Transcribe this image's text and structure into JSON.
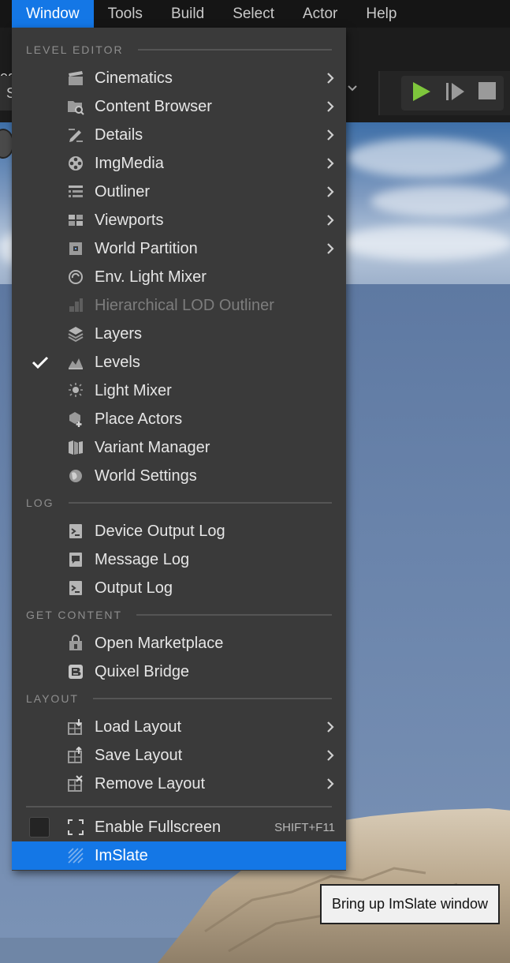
{
  "menubar": {
    "items": [
      {
        "label": "Window",
        "active": true
      },
      {
        "label": "Tools"
      },
      {
        "label": "Build"
      },
      {
        "label": "Select"
      },
      {
        "label": "Actor"
      },
      {
        "label": "Help"
      }
    ]
  },
  "toolbar": {
    "left_text": "ed",
    "combo_text": "S"
  },
  "menu": {
    "sections": [
      {
        "label": "LEVEL EDITOR",
        "items": [
          {
            "label": "Cinematics",
            "icon": "clapperboard-icon",
            "submenu": true
          },
          {
            "label": "Content Browser",
            "icon": "folder-search-icon",
            "submenu": true
          },
          {
            "label": "Details",
            "icon": "pencil-details-icon",
            "submenu": true
          },
          {
            "label": "ImgMedia",
            "icon": "film-reel-icon",
            "submenu": true
          },
          {
            "label": "Outliner",
            "icon": "outliner-list-icon",
            "submenu": true
          },
          {
            "label": "Viewports",
            "icon": "viewports-grid-icon",
            "submenu": true
          },
          {
            "label": "World Partition",
            "icon": "world-partition-icon",
            "submenu": true
          },
          {
            "label": "Env. Light Mixer",
            "icon": "env-light-icon"
          },
          {
            "label": "Hierarchical LOD Outliner",
            "icon": "hlod-icon",
            "disabled": true
          },
          {
            "label": "Layers",
            "icon": "layers-icon"
          },
          {
            "label": "Levels",
            "icon": "levels-icon",
            "checked": true
          },
          {
            "label": "Light Mixer",
            "icon": "light-mixer-icon"
          },
          {
            "label": "Place Actors",
            "icon": "place-actors-icon"
          },
          {
            "label": "Variant Manager",
            "icon": "variant-manager-icon"
          },
          {
            "label": "World Settings",
            "icon": "world-settings-icon"
          }
        ]
      },
      {
        "label": "LOG",
        "items": [
          {
            "label": "Device Output Log",
            "icon": "terminal-icon"
          },
          {
            "label": "Message Log",
            "icon": "message-log-icon"
          },
          {
            "label": "Output Log",
            "icon": "terminal-icon"
          }
        ]
      },
      {
        "label": "GET CONTENT",
        "items": [
          {
            "label": "Open Marketplace",
            "icon": "marketplace-icon"
          },
          {
            "label": "Quixel Bridge",
            "icon": "quixel-bridge-icon"
          }
        ]
      },
      {
        "label": "LAYOUT",
        "items": [
          {
            "label": "Load Layout",
            "icon": "load-layout-icon",
            "submenu": true
          },
          {
            "label": "Save Layout",
            "icon": "save-layout-icon",
            "submenu": true
          },
          {
            "label": "Remove Layout",
            "icon": "remove-layout-icon",
            "submenu": true
          }
        ]
      }
    ],
    "fullscreen": {
      "label": "Enable Fullscreen",
      "shortcut": "SHIFT+F11",
      "checked": false
    },
    "imslate": {
      "label": "ImSlate",
      "highlighted": true
    }
  },
  "tooltip": {
    "text": "Bring up ImSlate window"
  },
  "colors": {
    "accent": "#1477e6",
    "menu_bg": "#3a3a3a",
    "play_green": "#7ec63c"
  }
}
